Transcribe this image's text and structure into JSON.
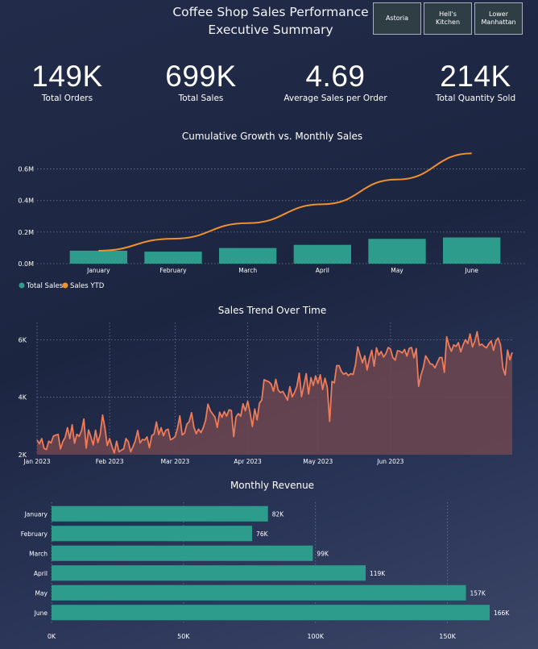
{
  "header": {
    "title_line1": "Coffee Shop Sales Performance",
    "title_line2": "Executive Summary"
  },
  "slicers": [
    "Astoria",
    "Hell's Kitchen",
    "Lower Manhattan"
  ],
  "kpis": [
    {
      "value": "149K",
      "label": "Total Orders"
    },
    {
      "value": "699K",
      "label": "Total Sales"
    },
    {
      "value": "4.69",
      "label": "Average Sales per Order"
    },
    {
      "value": "214K",
      "label": "Total Quantity Sold"
    }
  ],
  "colors": {
    "teal": "#2e9c8c",
    "orange": "#f0912d",
    "trend_line": "#ef7b58",
    "trend_fill": "#6e4650",
    "grid": "#6c7590"
  },
  "chart_data": [
    {
      "type": "bar+line",
      "title": "Cumulative Growth vs. Monthly Sales",
      "categories": [
        "January",
        "February",
        "March",
        "April",
        "May",
        "June"
      ],
      "series": [
        {
          "name": "Total Sales",
          "kind": "bar",
          "values": [
            82000,
            76000,
            99000,
            119000,
            157000,
            166000
          ]
        },
        {
          "name": "Sales YTD",
          "kind": "line",
          "values": [
            82000,
            158000,
            257000,
            376000,
            533000,
            699000
          ]
        }
      ],
      "y_ticks": [
        0,
        200000,
        400000,
        600000
      ],
      "y_tick_labels": [
        "0.0M",
        "0.2M",
        "0.4M",
        "0.6M"
      ],
      "ylim": [
        0,
        700000
      ],
      "legend": "bottom-left",
      "grid": true
    },
    {
      "type": "area",
      "title": "Sales Trend Over Time",
      "x_tick_labels": [
        "Jan 2023",
        "Feb 2023",
        "Mar 2023",
        "Apr 2023",
        "May 2023",
        "Jun 2023"
      ],
      "y_ticks": [
        2000,
        4000,
        6000
      ],
      "y_tick_labels": [
        "2K",
        "4K",
        "6K"
      ],
      "ylim": [
        2000,
        6600
      ],
      "grid": true,
      "values": [
        2510,
        2380,
        2560,
        2220,
        2180,
        2470,
        2410,
        2650,
        2680,
        2710,
        2200,
        2450,
        2600,
        2940,
        2560,
        3040,
        2400,
        2710,
        2640,
        2830,
        3240,
        2230,
        2860,
        2620,
        2340,
        2850,
        2420,
        2720,
        3380,
        2930,
        2320,
        2560,
        2290,
        2060,
        2470,
        2100,
        2160,
        2200,
        2560,
        2450,
        2100,
        2280,
        2490,
        2840,
        2410,
        2530,
        2510,
        2620,
        2240,
        2660,
        2720,
        3140,
        2700,
        2940,
        2660,
        2850,
        2890,
        2520,
        2560,
        2630,
        2910,
        3350,
        2690,
        2750,
        3060,
        3150,
        3460,
        2960,
        2730,
        2890,
        2770,
        2940,
        3200,
        3760,
        3540,
        3420,
        3310,
        2950,
        3480,
        3300,
        3500,
        3340,
        3560,
        3540,
        2630,
        3310,
        3430,
        3340,
        3770,
        3530,
        3860,
        3470,
        2980,
        3590,
        3210,
        3790,
        3900,
        4610,
        4570,
        4540,
        4460,
        4210,
        4620,
        4250,
        4160,
        4200,
        4060,
        3900,
        4370,
        4010,
        4160,
        4380,
        4840,
        4020,
        4420,
        4820,
        4110,
        4680,
        4410,
        4740,
        4480,
        4780,
        4270,
        4660,
        4340,
        3160,
        4550,
        4500,
        5100,
        5100,
        4900,
        4800,
        4850,
        4750,
        4820,
        4790,
        5120,
        5750,
        5470,
        5200,
        5440,
        4950,
        5350,
        5630,
        5080,
        5720,
        5460,
        5590,
        5400,
        5510,
        5730,
        5680,
        5380,
        5290,
        5620,
        5600,
        5540,
        5660,
        5430,
        5700,
        5730,
        5370,
        5690,
        4380,
        4770,
        5030,
        5440,
        5310,
        5160,
        5140,
        5020,
        5210,
        5380,
        5380,
        4870,
        6100,
        5800,
        5600,
        5820,
        5770,
        5900,
        5580,
        5820,
        6000,
        5870,
        6200,
        5750,
        5950,
        6280,
        5800,
        5850,
        5770,
        5720,
        5860,
        5960,
        5630,
        5950,
        6060,
        5820,
        5020,
        4770,
        5640,
        5300,
        5560
      ]
    },
    {
      "type": "hbar",
      "title": "Monthly Revenue",
      "categories": [
        "January",
        "February",
        "March",
        "April",
        "May",
        "June"
      ],
      "values": [
        82000,
        76000,
        99000,
        119000,
        157000,
        166000
      ],
      "value_labels": [
        "82K",
        "76K",
        "99K",
        "119K",
        "157K",
        "166K"
      ],
      "x_ticks": [
        0,
        50000,
        100000,
        150000
      ],
      "x_tick_labels": [
        "0K",
        "50K",
        "100K",
        "150K"
      ],
      "xlim": [
        0,
        170000
      ],
      "grid": true
    }
  ]
}
